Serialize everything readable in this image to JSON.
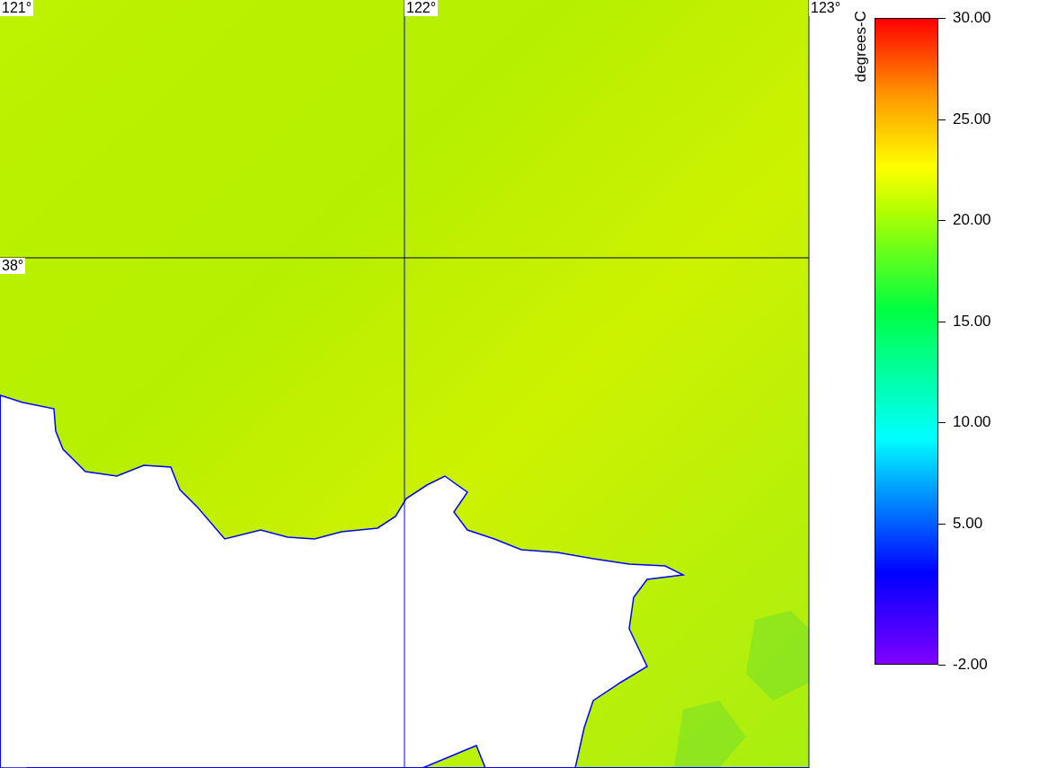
{
  "map": {
    "lon_labels": [
      "121°",
      "122°",
      "123°"
    ],
    "lat_labels": [
      "38°"
    ]
  },
  "colorbar": {
    "title": "degrees-C",
    "ticks": [
      "30.00",
      "25.00",
      "20.00",
      "15.00",
      "10.00",
      "5.00",
      "-2.00"
    ]
  }
}
